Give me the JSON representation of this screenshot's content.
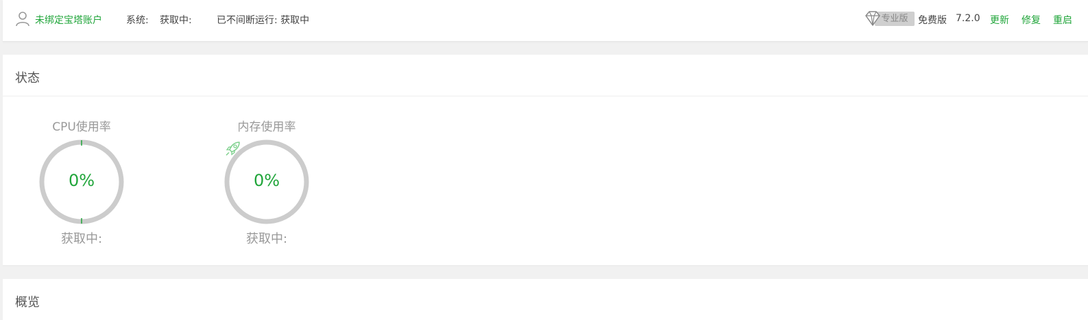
{
  "header": {
    "account_link": "未绑定宝塔账户",
    "system_label": "系统:",
    "system_value": "获取中:",
    "uptime": "已不间断运行: 获取中",
    "pro_badge": "专业版",
    "free_label": "免费版",
    "version": "7.2.0",
    "actions": {
      "update": "更新",
      "repair": "修复",
      "restart": "重启"
    }
  },
  "status_panel": {
    "title": "状态",
    "gauges": [
      {
        "title": "CPU使用率",
        "value": "0%",
        "status": "获取中:",
        "percent": 0
      },
      {
        "title": "内存使用率",
        "value": "0%",
        "status": "获取中:",
        "percent": 0
      }
    ]
  },
  "overview_panel": {
    "title": "概览"
  },
  "colors": {
    "accent": "#20a53a",
    "ring": "#cccccc",
    "pro_badge_bg": "#cfcfcf"
  },
  "icons": [
    "user-icon",
    "diamond-icon",
    "rocket-icon"
  ]
}
